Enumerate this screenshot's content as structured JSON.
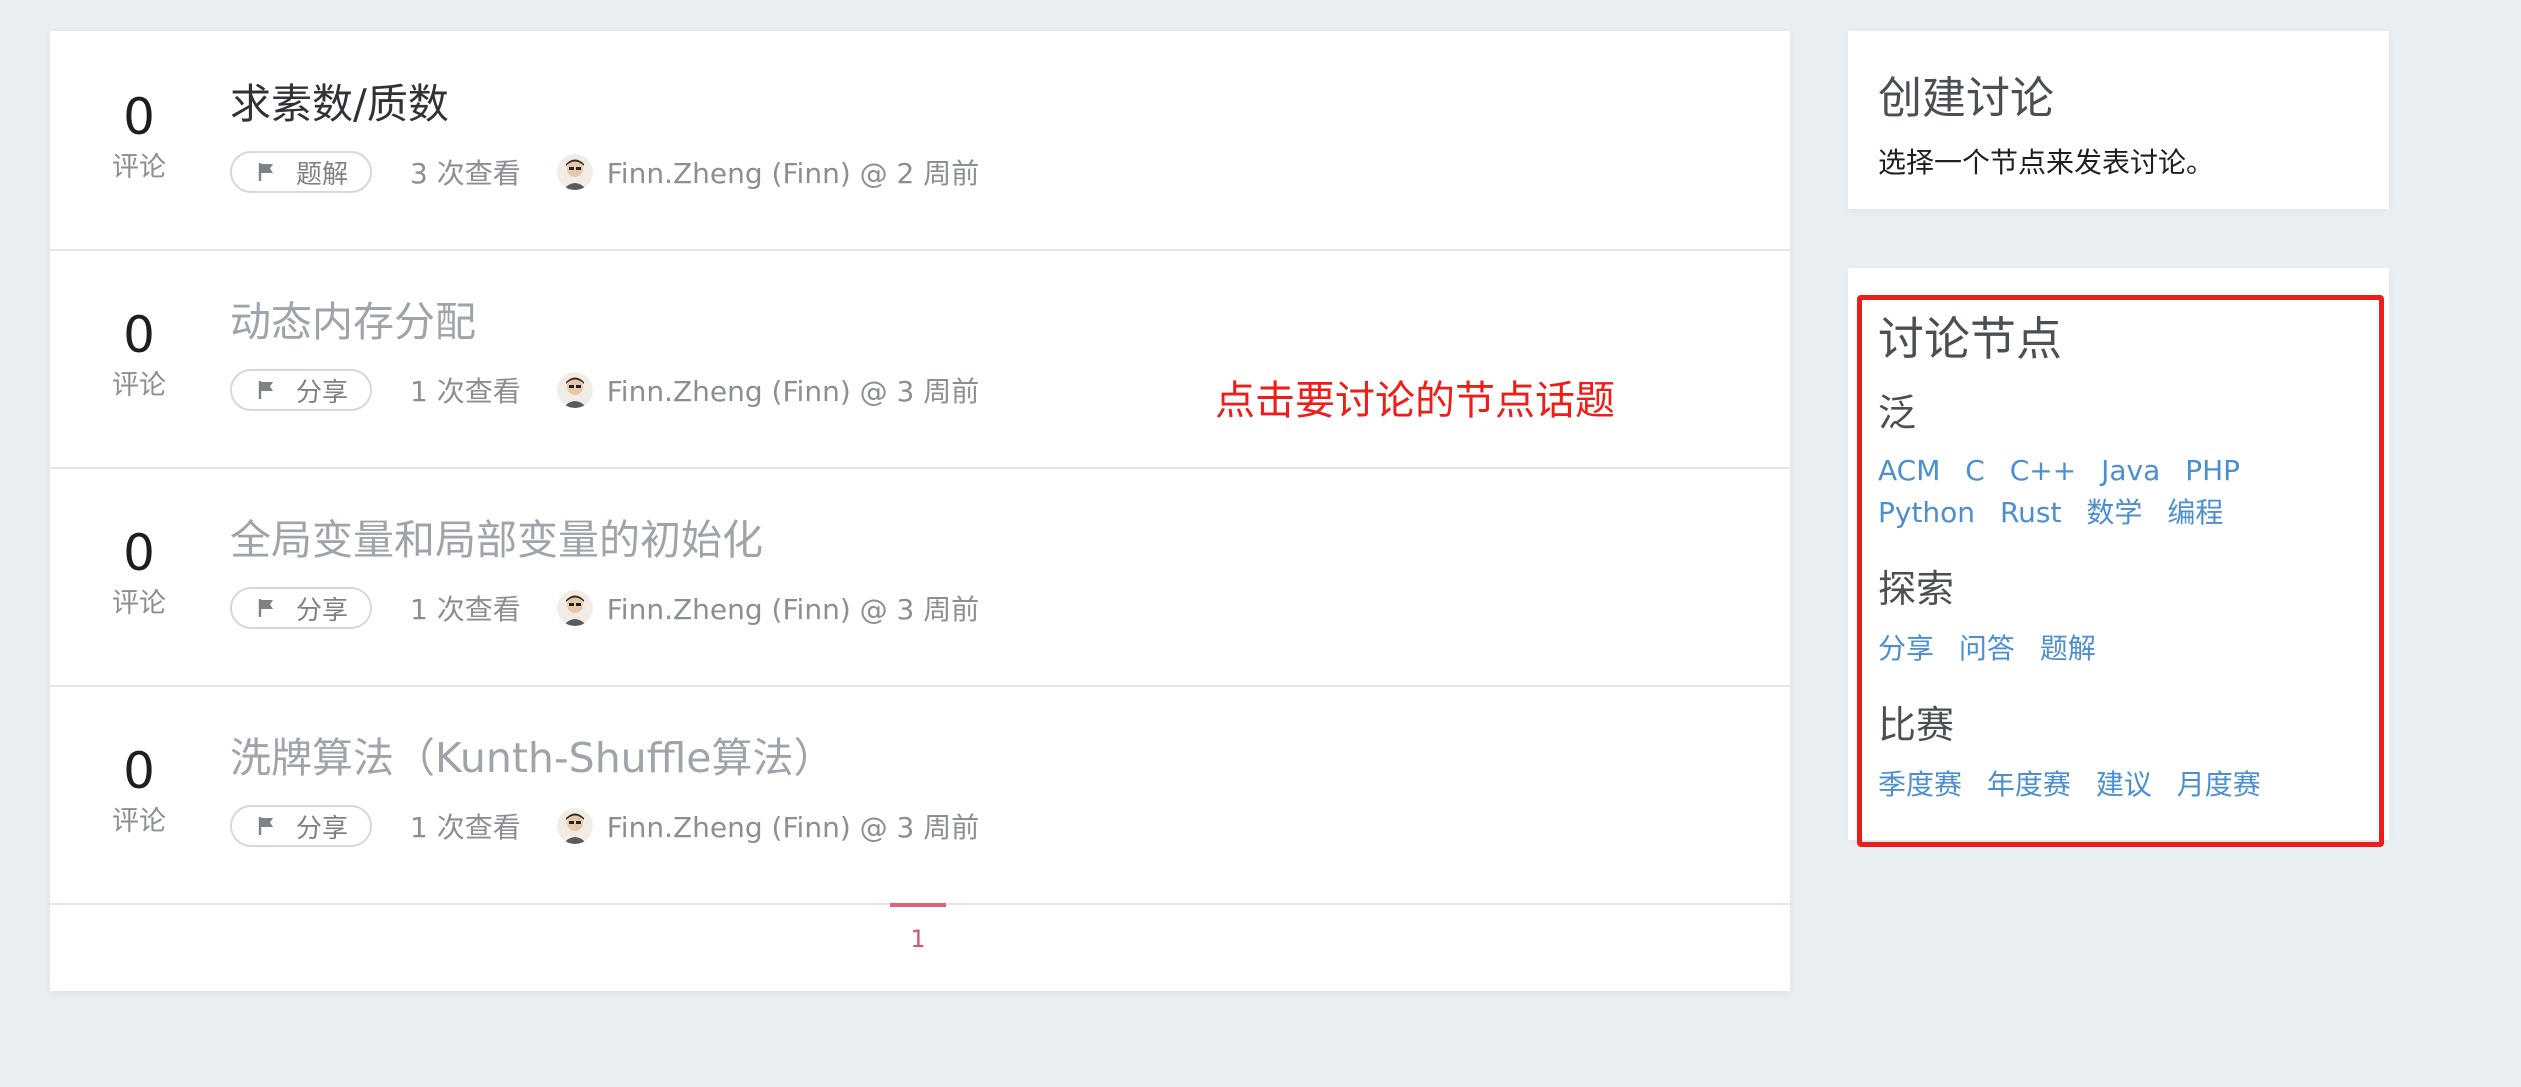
{
  "topics": [
    {
      "count": "0",
      "count_label": "评论",
      "title": "求素数/质数",
      "tag": "题解",
      "views": "3 次查看",
      "author": "Finn.Zheng (Finn) @ 2 周前"
    },
    {
      "count": "0",
      "count_label": "评论",
      "title": "动态内存分配",
      "tag": "分享",
      "views": "1 次查看",
      "author": "Finn.Zheng (Finn) @ 3 周前"
    },
    {
      "count": "0",
      "count_label": "评论",
      "title": "全局变量和局部变量的初始化",
      "tag": "分享",
      "views": "1 次查看",
      "author": "Finn.Zheng (Finn) @ 3 周前"
    },
    {
      "count": "0",
      "count_label": "评论",
      "title": "洗牌算法（Kunth-Shuffle算法）",
      "tag": "分享",
      "views": "1 次查看",
      "author": "Finn.Zheng (Finn) @ 3 周前"
    }
  ],
  "annotation": "点击要讨论的节点话题",
  "pagination": {
    "current": "1"
  },
  "sidebar": {
    "create": {
      "title": "创建讨论",
      "desc": "选择一个节点来发表讨论。"
    },
    "nodes": {
      "title": "讨论节点",
      "groups": [
        {
          "name": "泛",
          "items": [
            "ACM",
            "C",
            "C++",
            "Java",
            "PHP",
            "Python",
            "Rust",
            "数学",
            "编程"
          ]
        },
        {
          "name": "探索",
          "items": [
            "分享",
            "问答",
            "题解"
          ]
        },
        {
          "name": "比赛",
          "items": [
            "季度赛",
            "年度赛",
            "建议",
            "月度赛"
          ]
        }
      ]
    }
  },
  "colors": {
    "background": "#e9eef2",
    "link": "#4b8fd0",
    "annotation": "#f01c16",
    "pagination_active": "#d9536d"
  }
}
